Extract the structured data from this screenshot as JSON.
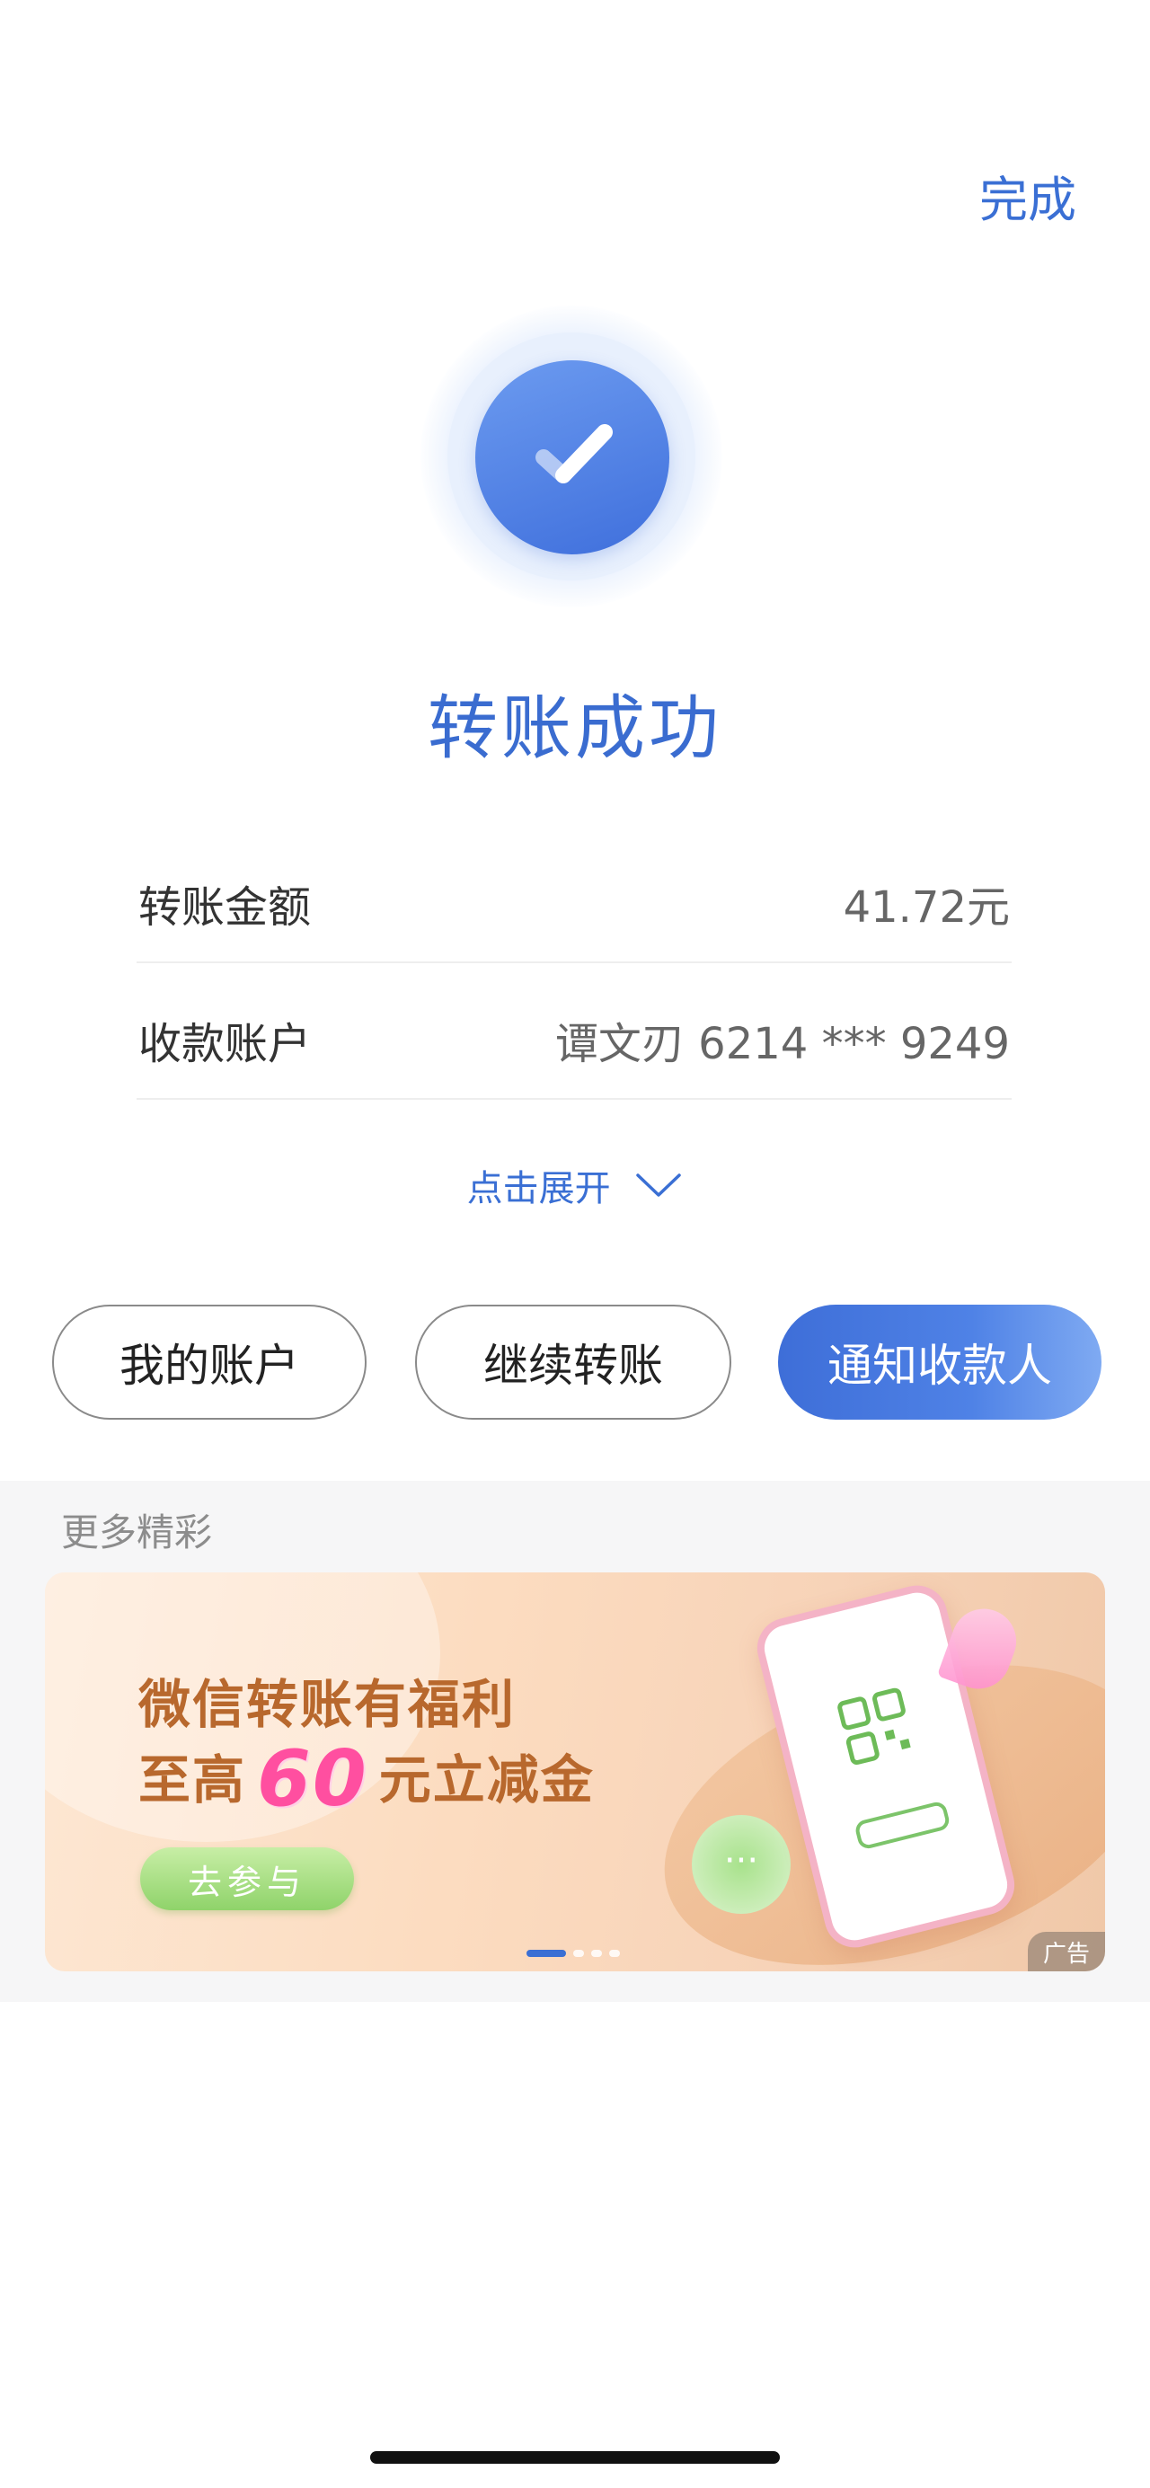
{
  "header": {
    "done_label": "完成"
  },
  "status": {
    "title": "转账成功"
  },
  "details": {
    "amount_label": "转账金额",
    "amount_value": "41.72元",
    "account_label": "收款账户",
    "account_value": "谭文刃 6214 *** 9249"
  },
  "expand": {
    "label": "点击展开"
  },
  "actions": {
    "my_account": "我的账户",
    "continue_transfer": "继续转账",
    "notify_payee": "通知收款人"
  },
  "more": {
    "title": "更多精彩",
    "banner": {
      "line1": "微信转账有福利",
      "line2_prefix": "至高",
      "line2_amount": "60",
      "line2_suffix": "元立减金",
      "cta": "去参与",
      "ad_tag": "广告",
      "bubble_text": "···",
      "carousel_total": 4,
      "carousel_active": 1
    }
  },
  "colors": {
    "accent": "#3a6fd4",
    "title": "#3a6cd0",
    "banner_text": "#b8682d",
    "banner_highlight": "#ff4fa0"
  },
  "icons": {
    "success": "check-circle-icon",
    "expand": "chevron-down-icon",
    "qr": "qr-code-icon",
    "chat": "chat-bubble-icon"
  }
}
